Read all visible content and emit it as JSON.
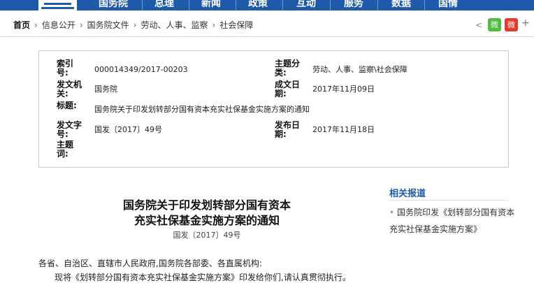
{
  "nav": {
    "items": [
      "国务院",
      "总理",
      "新闻",
      "政策",
      "互动",
      "服务",
      "数据",
      "国情"
    ]
  },
  "breadcrumb": {
    "home": "首页",
    "sep": "›",
    "items": [
      "信息公开",
      "国务院文件",
      "劳动、人事、监察",
      "社会保障"
    ]
  },
  "share": {
    "share_icon": "<",
    "wechat": "微",
    "weibo": "微",
    "plus": "+"
  },
  "meta": {
    "index_label": "索引号:",
    "index_value": "000014349/2017-00203",
    "topic_label": "主题分类:",
    "topic_value": "劳动、人事、监察\\社会保障",
    "issuer_label": "发文机关:",
    "issuer_value": "国务院",
    "created_label": "成文日期:",
    "created_value": "2017年11月09日",
    "title_label": "标题:",
    "title_value": "国务院关于印发划转部分国有资本充实社保基金实施方案的通知",
    "docno_label": "发文字号:",
    "docno_value": "国发〔2017〕49号",
    "published_label": "发布日期:",
    "published_value": "2017年11月18日",
    "keywords_label": "主题词:",
    "keywords_value": ""
  },
  "article": {
    "title_line1": "国务院关于印发划转部分国有资本",
    "title_line2": "充实社保基金实施方案的通知",
    "doc_number": "国发〔2017〕49号",
    "para1": "各省、自治区、直辖市人民政府,国务院各部委、各直属机构:",
    "para2": "现将《划转部分国有资本充实社保基金实施方案》印发给你们,请认真贯彻执行。"
  },
  "related": {
    "title": "相关报道",
    "items": [
      "国务院印发《划转部分国有资本充实社保基金实施方案》"
    ]
  },
  "colors": {
    "nav_blue": "#1d5aa8",
    "wechat_green": "#4cbf3f",
    "weibo_red": "#e33a2f"
  }
}
